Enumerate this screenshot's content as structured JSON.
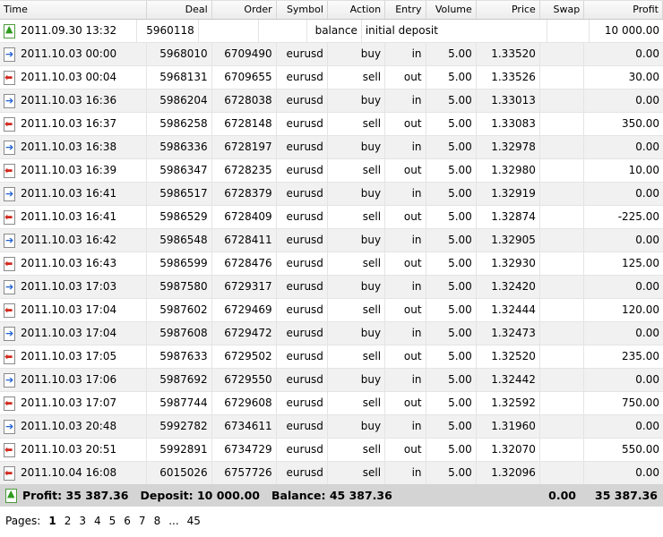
{
  "columns": [
    "Time",
    "Deal",
    "Order",
    "Symbol",
    "Action",
    "Entry",
    "Volume",
    "Price",
    "Swap",
    "Profit"
  ],
  "balance_row": {
    "time": "2011.09.30 13:32",
    "deal": "5960118",
    "action": "balance",
    "entry": "initial deposit",
    "profit": "10 000.00",
    "icon": "deposit-icon"
  },
  "rows": [
    {
      "time": "2011.10.03 00:00",
      "deal": "5968010",
      "order": "6709490",
      "symbol": "eurusd",
      "action": "buy",
      "entry": "in",
      "volume": "5.00",
      "price": "1.33520",
      "profit": "0.00"
    },
    {
      "time": "2011.10.03 00:04",
      "deal": "5968131",
      "order": "6709655",
      "symbol": "eurusd",
      "action": "sell",
      "entry": "out",
      "volume": "5.00",
      "price": "1.33526",
      "profit": "30.00"
    },
    {
      "time": "2011.10.03 16:36",
      "deal": "5986204",
      "order": "6728038",
      "symbol": "eurusd",
      "action": "buy",
      "entry": "in",
      "volume": "5.00",
      "price": "1.33013",
      "profit": "0.00"
    },
    {
      "time": "2011.10.03 16:37",
      "deal": "5986258",
      "order": "6728148",
      "symbol": "eurusd",
      "action": "sell",
      "entry": "out",
      "volume": "5.00",
      "price": "1.33083",
      "profit": "350.00"
    },
    {
      "time": "2011.10.03 16:38",
      "deal": "5986336",
      "order": "6728197",
      "symbol": "eurusd",
      "action": "buy",
      "entry": "in",
      "volume": "5.00",
      "price": "1.32978",
      "profit": "0.00"
    },
    {
      "time": "2011.10.03 16:39",
      "deal": "5986347",
      "order": "6728235",
      "symbol": "eurusd",
      "action": "sell",
      "entry": "out",
      "volume": "5.00",
      "price": "1.32980",
      "profit": "10.00"
    },
    {
      "time": "2011.10.03 16:41",
      "deal": "5986517",
      "order": "6728379",
      "symbol": "eurusd",
      "action": "buy",
      "entry": "in",
      "volume": "5.00",
      "price": "1.32919",
      "profit": "0.00"
    },
    {
      "time": "2011.10.03 16:41",
      "deal": "5986529",
      "order": "6728409",
      "symbol": "eurusd",
      "action": "sell",
      "entry": "out",
      "volume": "5.00",
      "price": "1.32874",
      "profit": "-225.00"
    },
    {
      "time": "2011.10.03 16:42",
      "deal": "5986548",
      "order": "6728411",
      "symbol": "eurusd",
      "action": "buy",
      "entry": "in",
      "volume": "5.00",
      "price": "1.32905",
      "profit": "0.00"
    },
    {
      "time": "2011.10.03 16:43",
      "deal": "5986599",
      "order": "6728476",
      "symbol": "eurusd",
      "action": "sell",
      "entry": "out",
      "volume": "5.00",
      "price": "1.32930",
      "profit": "125.00"
    },
    {
      "time": "2011.10.03 17:03",
      "deal": "5987580",
      "order": "6729317",
      "symbol": "eurusd",
      "action": "buy",
      "entry": "in",
      "volume": "5.00",
      "price": "1.32420",
      "profit": "0.00"
    },
    {
      "time": "2011.10.03 17:04",
      "deal": "5987602",
      "order": "6729469",
      "symbol": "eurusd",
      "action": "sell",
      "entry": "out",
      "volume": "5.00",
      "price": "1.32444",
      "profit": "120.00"
    },
    {
      "time": "2011.10.03 17:04",
      "deal": "5987608",
      "order": "6729472",
      "symbol": "eurusd",
      "action": "buy",
      "entry": "in",
      "volume": "5.00",
      "price": "1.32473",
      "profit": "0.00"
    },
    {
      "time": "2011.10.03 17:05",
      "deal": "5987633",
      "order": "6729502",
      "symbol": "eurusd",
      "action": "sell",
      "entry": "out",
      "volume": "5.00",
      "price": "1.32520",
      "profit": "235.00"
    },
    {
      "time": "2011.10.03 17:06",
      "deal": "5987692",
      "order": "6729550",
      "symbol": "eurusd",
      "action": "buy",
      "entry": "in",
      "volume": "5.00",
      "price": "1.32442",
      "profit": "0.00"
    },
    {
      "time": "2011.10.03 17:07",
      "deal": "5987744",
      "order": "6729608",
      "symbol": "eurusd",
      "action": "sell",
      "entry": "out",
      "volume": "5.00",
      "price": "1.32592",
      "profit": "750.00"
    },
    {
      "time": "2011.10.03 20:48",
      "deal": "5992782",
      "order": "6734611",
      "symbol": "eurusd",
      "action": "buy",
      "entry": "in",
      "volume": "5.00",
      "price": "1.31960",
      "profit": "0.00"
    },
    {
      "time": "2011.10.03 20:51",
      "deal": "5992891",
      "order": "6734729",
      "symbol": "eurusd",
      "action": "sell",
      "entry": "out",
      "volume": "5.00",
      "price": "1.32070",
      "profit": "550.00"
    },
    {
      "time": "2011.10.04 16:08",
      "deal": "6015026",
      "order": "6757726",
      "symbol": "eurusd",
      "action": "sell",
      "entry": "in",
      "volume": "5.00",
      "price": "1.32096",
      "profit": "0.00"
    }
  ],
  "summary": {
    "text": "Profit: 35 387.36   Deposit: 10 000.00   Balance: 45 387.36",
    "swap": "0.00",
    "profit": "35 387.36"
  },
  "pager": {
    "label": "Pages:",
    "current": "1",
    "pages": [
      "2",
      "3",
      "4",
      "5",
      "6",
      "7",
      "8"
    ],
    "ellipsis": "...",
    "last": "45"
  },
  "icons": {
    "buy": "buy-deal-icon",
    "sell": "sell-deal-icon",
    "balance": "deposit-icon"
  },
  "colors": {
    "buy_arrow": "#1f5fd6",
    "sell_arrow": "#d0281e",
    "deposit_arrow": "#2e9a1e",
    "summary_bg": "#d4d4d4",
    "alt_row": "#f1f1f1"
  }
}
